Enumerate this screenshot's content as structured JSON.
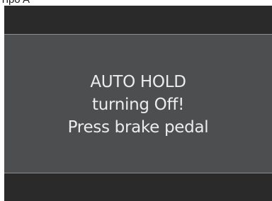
{
  "caption": "Tipo A",
  "display": {
    "message_lines": [
      "AUTO HOLD",
      "turning Off!",
      "Press brake pedal"
    ]
  }
}
